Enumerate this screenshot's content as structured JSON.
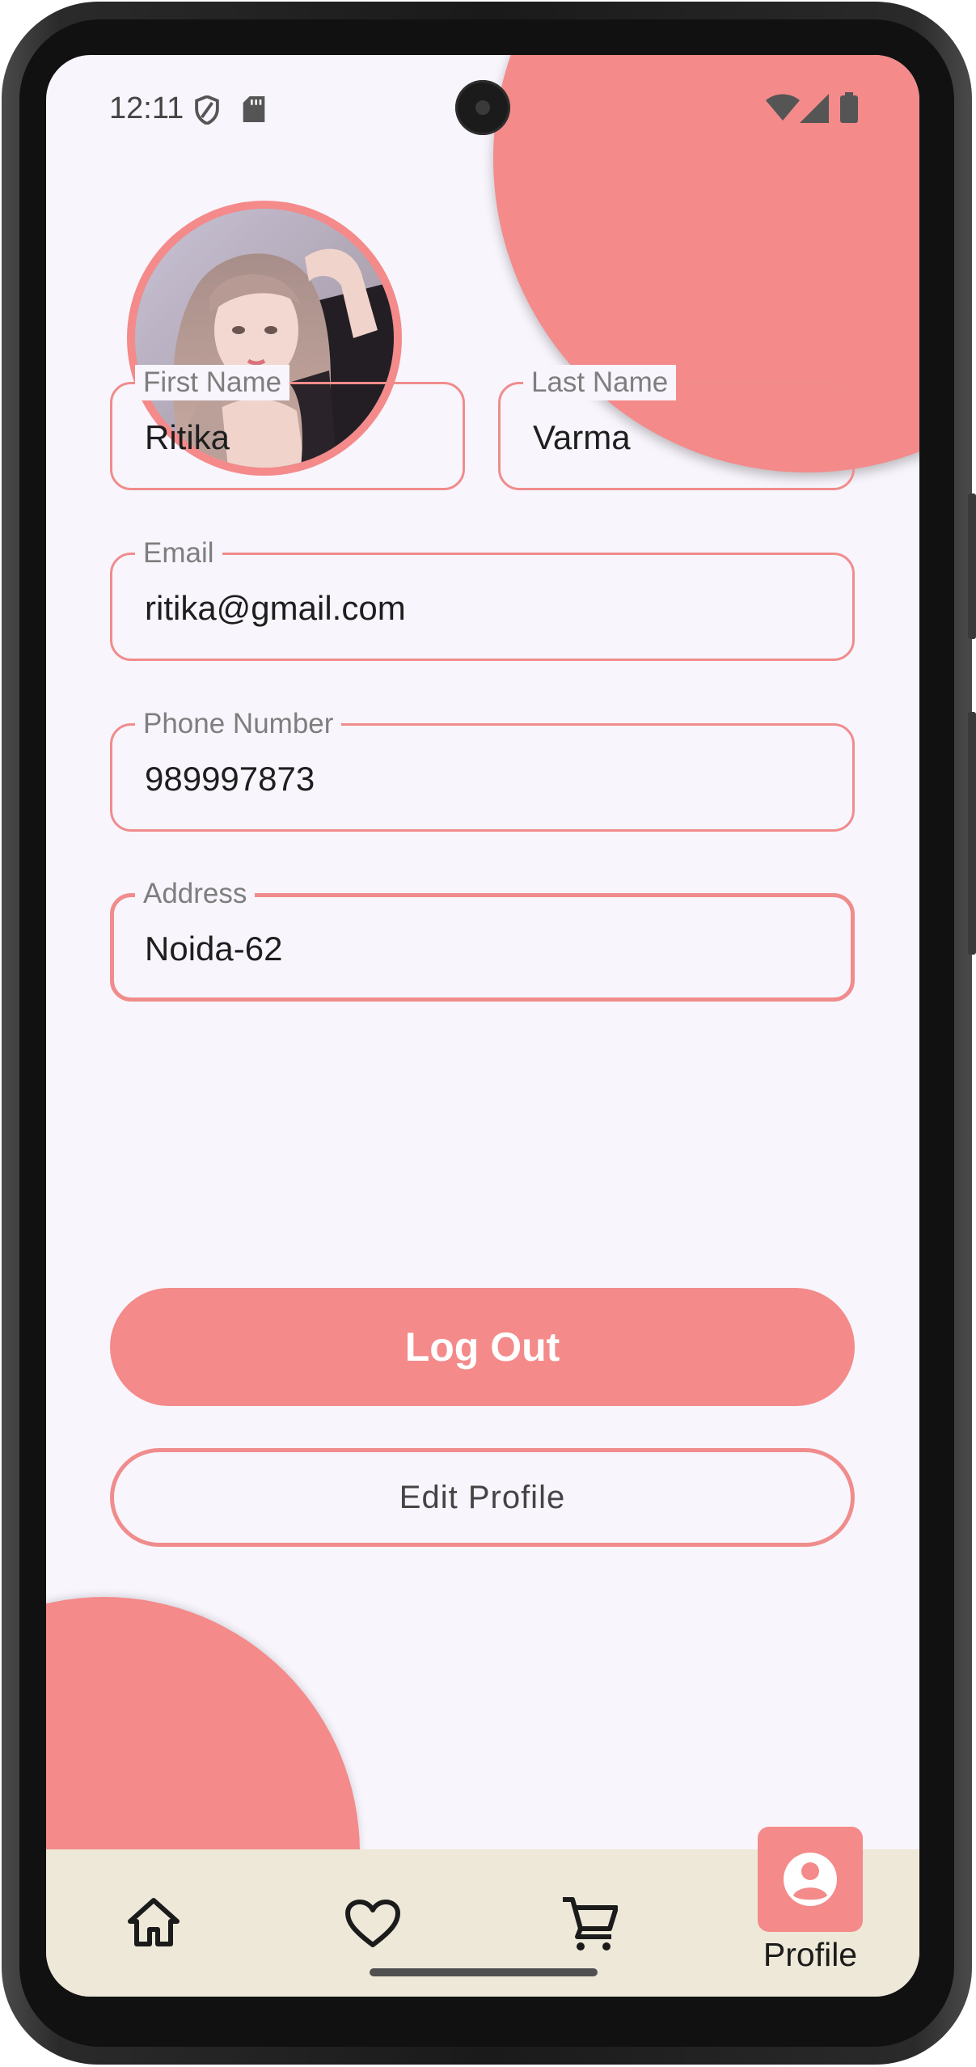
{
  "status_bar": {
    "time": "12:11",
    "left_icons": [
      "shield-icon",
      "sd-card-icon"
    ],
    "right_icons": [
      "wifi-icon",
      "signal-icon",
      "battery-icon"
    ]
  },
  "profile": {
    "avatar_alt": "profile-photo"
  },
  "form": {
    "first_name": {
      "label": "First Name",
      "value": "Ritika"
    },
    "last_name": {
      "label": "Last Name",
      "value": "Varma"
    },
    "email": {
      "label": "Email",
      "value": "ritika@gmail.com"
    },
    "phone": {
      "label": "Phone Number",
      "value": "989997873"
    },
    "address": {
      "label": "Address",
      "value": "Noida-62"
    }
  },
  "actions": {
    "logout_label": "Log Out",
    "edit_label": "Edit Profile"
  },
  "nav": {
    "items": [
      {
        "icon": "home-icon",
        "label": ""
      },
      {
        "icon": "heart-icon",
        "label": ""
      },
      {
        "icon": "cart-icon",
        "label": ""
      },
      {
        "icon": "account-icon",
        "label": "Profile",
        "active": true
      }
    ],
    "active_label": "Profile"
  },
  "colors": {
    "accent": "#f48a8a",
    "background": "#f8f5fc",
    "nav_background": "#ede8d8"
  }
}
